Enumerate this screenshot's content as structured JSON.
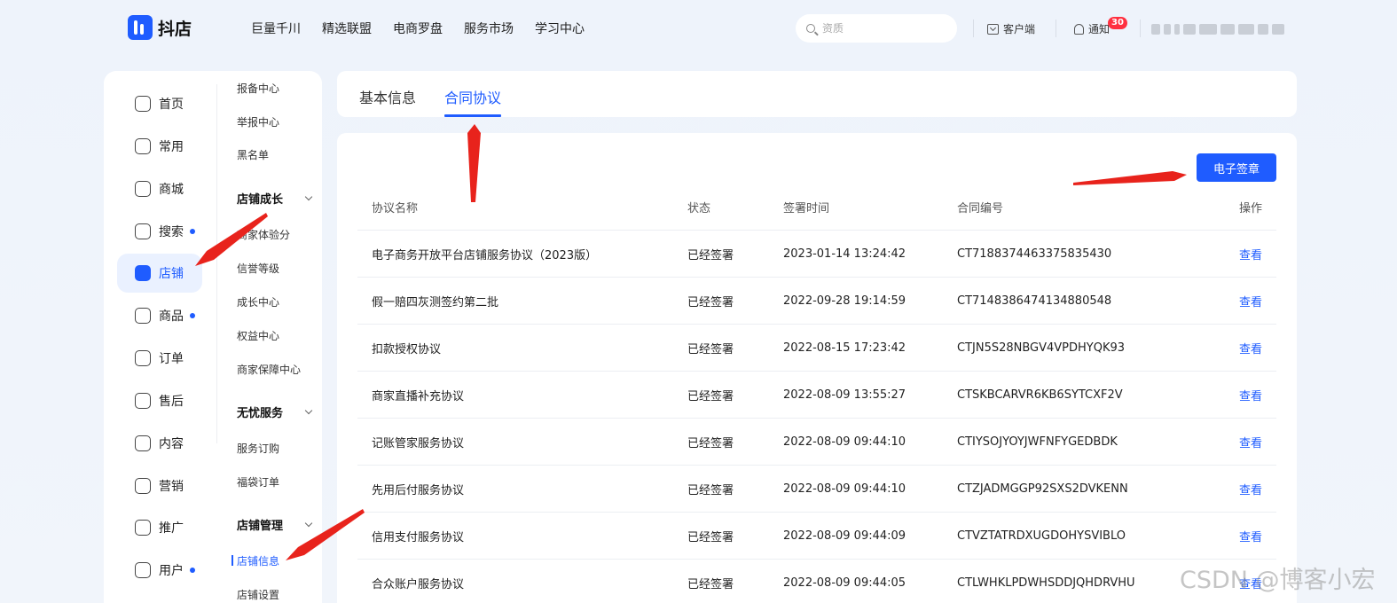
{
  "header": {
    "logo_text": "抖店",
    "nav": [
      "巨量千川",
      "精选联盟",
      "电商罗盘",
      "服务市场",
      "学习中心"
    ],
    "search_placeholder": "资质",
    "client_label": "客户端",
    "notify_label": "通知",
    "notify_count": "30"
  },
  "sidebar": {
    "primary": [
      {
        "label": "首页",
        "dot": false
      },
      {
        "label": "常用",
        "dot": false
      },
      {
        "label": "商城",
        "dot": false
      },
      {
        "label": "搜索",
        "dot": true
      },
      {
        "label": "店铺",
        "dot": false,
        "active": true
      },
      {
        "label": "商品",
        "dot": true
      },
      {
        "label": "订单",
        "dot": false
      },
      {
        "label": "售后",
        "dot": false
      },
      {
        "label": "内容",
        "dot": false
      },
      {
        "label": "营销",
        "dot": false
      },
      {
        "label": "推广",
        "dot": false
      },
      {
        "label": "用户",
        "dot": true
      }
    ],
    "secondary": {
      "item_reporting": "报备中心",
      "item_report": "举报中心",
      "item_blacklist": "黑名单",
      "group_growth": "店铺成长",
      "item_experience": "商家体验分",
      "item_credit": "信誉等级",
      "item_growth_center": "成长中心",
      "item_rights": "权益中心",
      "item_guarantee": "商家保障中心",
      "group_worryfree": "无忧服务",
      "item_service_order": "服务订购",
      "item_bag_order": "福袋订单",
      "group_manage": "店铺管理",
      "item_shop_info": "店铺信息",
      "item_shop_settings": "店铺设置"
    }
  },
  "tabs": {
    "basic": "基本信息",
    "contract": "合同协议"
  },
  "actions": {
    "esign": "电子签章"
  },
  "table": {
    "headers": {
      "name": "协议名称",
      "status": "状态",
      "time": "签署时间",
      "number": "合同编号",
      "op": "操作"
    },
    "rows": [
      {
        "name": "电子商务开放平台店铺服务协议（2023版）",
        "status": "已经签署",
        "time": "2023-01-14 13:24:42",
        "number": "CT7188374463375835430",
        "op": "查看"
      },
      {
        "name": "假一赔四灰测签约第二批",
        "status": "已经签署",
        "time": "2022-09-28 19:14:59",
        "number": "CT7148386474134880548",
        "op": "查看"
      },
      {
        "name": "扣款授权协议",
        "status": "已经签署",
        "time": "2022-08-15 17:23:42",
        "number": "CTJN5S28NBGV4VPDHYQK93",
        "op": "查看"
      },
      {
        "name": "商家直播补充协议",
        "status": "已经签署",
        "time": "2022-08-09 13:55:27",
        "number": "CTSKBCARVR6KB6SYTCXF2V",
        "op": "查看"
      },
      {
        "name": "记账管家服务协议",
        "status": "已经签署",
        "time": "2022-08-09 09:44:10",
        "number": "CTIYSOJYOYJWFNFYGEDBDK",
        "op": "查看"
      },
      {
        "name": "先用后付服务协议",
        "status": "已经签署",
        "time": "2022-08-09 09:44:10",
        "number": "CTZJADMGGP92SXS2DVKENN",
        "op": "查看"
      },
      {
        "name": "信用支付服务协议",
        "status": "已经签署",
        "time": "2022-08-09 09:44:09",
        "number": "CTVZTATRDXUGDOHYSVIBLO",
        "op": "查看"
      },
      {
        "name": "合众账户服务协议",
        "status": "已经签署",
        "time": "2022-08-09 09:44:05",
        "number": "CTLWHKLPDWHSDDJQHDRVHU",
        "op": "查看"
      }
    ]
  },
  "watermark": "CSDN @博客小宏",
  "colors": {
    "accent": "#1f5cff",
    "badge": "#ff3040",
    "annotation": "#e8231c"
  }
}
